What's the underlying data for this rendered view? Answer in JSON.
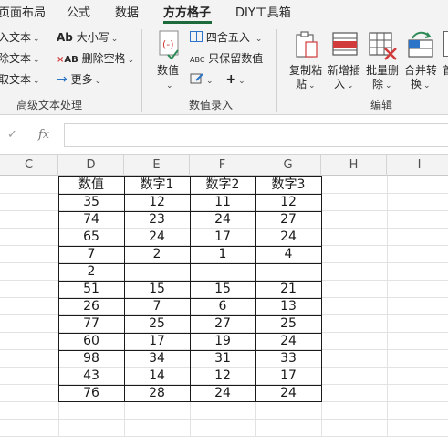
{
  "tabs": [
    {
      "label": "页面布局",
      "active": false
    },
    {
      "label": "公式",
      "active": false
    },
    {
      "label": "数据",
      "active": false
    },
    {
      "label": "方方格子",
      "active": true
    },
    {
      "label": "DIY工具箱",
      "active": false
    }
  ],
  "ribbon": {
    "text_group": {
      "items": [
        {
          "label": "入文本",
          "icon": "insert-text-icon"
        },
        {
          "label": "除文本",
          "icon": "delete-text-icon"
        },
        {
          "label": "取文本",
          "icon": "extract-text-icon"
        }
      ],
      "case_label": "大小写",
      "case_icon_text": "Ab",
      "remove_spaces_label": "删除空格",
      "remove_spaces_icon_text": "AB",
      "more_label": "更多",
      "group_label": "高级文本处理"
    },
    "numeric_group": {
      "number_label": "数值",
      "round_label": "四舍五入",
      "keep_numbers_label": "只保留数值",
      "keep_numbers_icon_text": "ABC",
      "group_label": "数值录入"
    },
    "edit_group": {
      "copy_paste_label": "复制粘",
      "copy_paste_label2": "贴",
      "insert_label": "新增插",
      "insert_label2": "入",
      "batch_delete_label": "批量删",
      "batch_delete_label2": "除",
      "merge_label": "合并转",
      "merge_label2": "换",
      "truncated_label": "首",
      "group_label": "编辑"
    }
  },
  "formula_bar": {
    "cancel_symbol": "✓",
    "fx_label": "fx",
    "value": ""
  },
  "columns": [
    "C",
    "D",
    "E",
    "F",
    "G",
    "H",
    "I"
  ],
  "table": {
    "headers": [
      "数值",
      "数字1",
      "数字2",
      "数字3"
    ],
    "rows": [
      [
        "35",
        "12",
        "11",
        "12"
      ],
      [
        "74",
        "23",
        "24",
        "27"
      ],
      [
        "65",
        "24",
        "17",
        "24"
      ],
      [
        "7",
        "2",
        "1",
        "4"
      ],
      [
        "2",
        "",
        "",
        ""
      ],
      [
        "51",
        "15",
        "15",
        "21"
      ],
      [
        "26",
        "7",
        "6",
        "13"
      ],
      [
        "77",
        "25",
        "27",
        "25"
      ],
      [
        "60",
        "17",
        "19",
        "24"
      ],
      [
        "98",
        "34",
        "31",
        "33"
      ],
      [
        "43",
        "14",
        "12",
        "17"
      ],
      [
        "76",
        "28",
        "24",
        "24"
      ]
    ]
  },
  "colors": {
    "accent": "#1d6b3a",
    "ribbon_bg": "#f3f3f3",
    "icon_red": "#d23b3b",
    "icon_blue": "#2b74c7",
    "icon_green": "#2e8b57"
  }
}
